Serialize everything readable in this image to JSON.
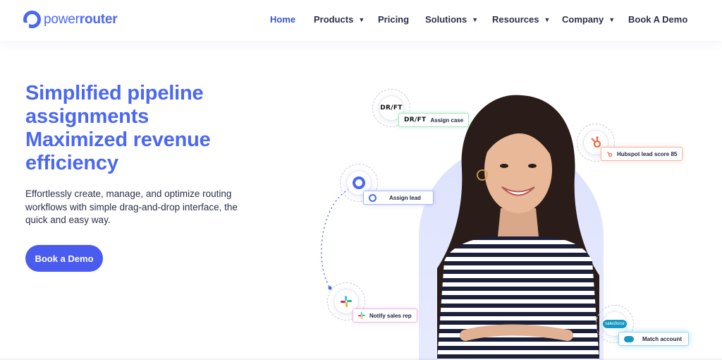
{
  "brand": {
    "name_power": "power",
    "name_router": "router"
  },
  "nav": {
    "items": [
      {
        "label": "Home",
        "active": true,
        "dropdown": false
      },
      {
        "label": "Products",
        "active": false,
        "dropdown": true
      },
      {
        "label": "Pricing",
        "active": false,
        "dropdown": false
      },
      {
        "label": "Solutions",
        "active": false,
        "dropdown": true
      },
      {
        "label": "Resources",
        "active": false,
        "dropdown": true
      },
      {
        "label": "Company",
        "active": false,
        "dropdown": true
      },
      {
        "label": "Book A Demo",
        "active": false,
        "dropdown": false
      }
    ]
  },
  "hero": {
    "headline_line1": "Simplified pipeline",
    "headline_line2": "assignments",
    "headline_line3": "Maximized revenue",
    "headline_line4": "efficiency",
    "subtext": "Effortlessly create, manage, and optimize routing workflows with simple drag-and-drop interface, the quick and easy way.",
    "cta_label": "Book a Demo"
  },
  "integrations": {
    "drift": {
      "logo_text": "DR/FT",
      "chip_label": "Assign case"
    },
    "hubspot": {
      "chip_label": "Hubspot lead score 85"
    },
    "powerrouter": {
      "chip_label": "Assign lead"
    },
    "slack": {
      "chip_label": "Notify sales rep"
    },
    "salesforce": {
      "logo_text": "salesforce",
      "chip_label": "Match account"
    }
  },
  "colors": {
    "brand_blue": "#4a67f5",
    "cta_blue": "#4a5cf0",
    "nav_active": "#3a55c8",
    "blob": "#dde2fd"
  },
  "icons": [
    "chevron-down-icon",
    "powerrouter-logo-icon",
    "drift-logo",
    "hubspot-icon",
    "slack-icon",
    "salesforce-icon"
  ]
}
